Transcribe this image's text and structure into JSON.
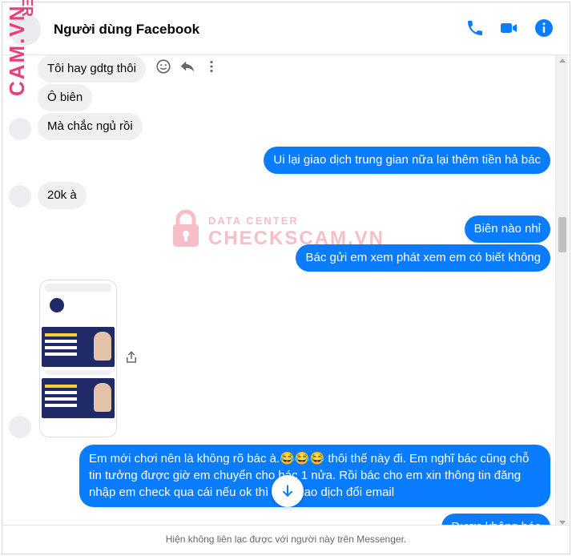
{
  "watermark": {
    "side_text": "CAM.VN",
    "side_top": "ER",
    "top_text": "DATA CENTER",
    "main_text": "CHECKSCAM.VN"
  },
  "header": {
    "title": "Người dùng Facebook",
    "icons": [
      "phone-icon",
      "video-call-icon",
      "info-icon"
    ],
    "accent": "#0a7cff"
  },
  "messages": [
    {
      "side": "in",
      "text": "Tôi hay gdtg thôi"
    },
    {
      "side": "in",
      "text": "Ô biên"
    },
    {
      "side": "in",
      "text": "Mà chắc ngủ rồi"
    },
    {
      "side": "out",
      "text": "Ui lại giao dịch trung gian nữa lại thêm tiền hả bác"
    },
    {
      "side": "in",
      "text": "20k à"
    },
    {
      "side": "out",
      "text": "Biên nào nhỉ"
    },
    {
      "side": "out",
      "text": "Bác gửi em xem phát xem em có biết không"
    },
    {
      "side": "out",
      "text": "Em mới chơi nên là không rõ bác à.😂😂😂 thôi thế này đi. Em nghĩ bác cũng chỗ tin tưởng được giờ em chuyển cho bác 1 nửa. Rồi bác cho em xin thông tin đăng nhập em check qua cái nếu ok thì bác giao dịch đổi email"
    },
    {
      "side": "out",
      "text": "Được không bác"
    }
  ],
  "footer": {
    "notice": "Hiện không liên lạc được với người này trên Messenger."
  }
}
